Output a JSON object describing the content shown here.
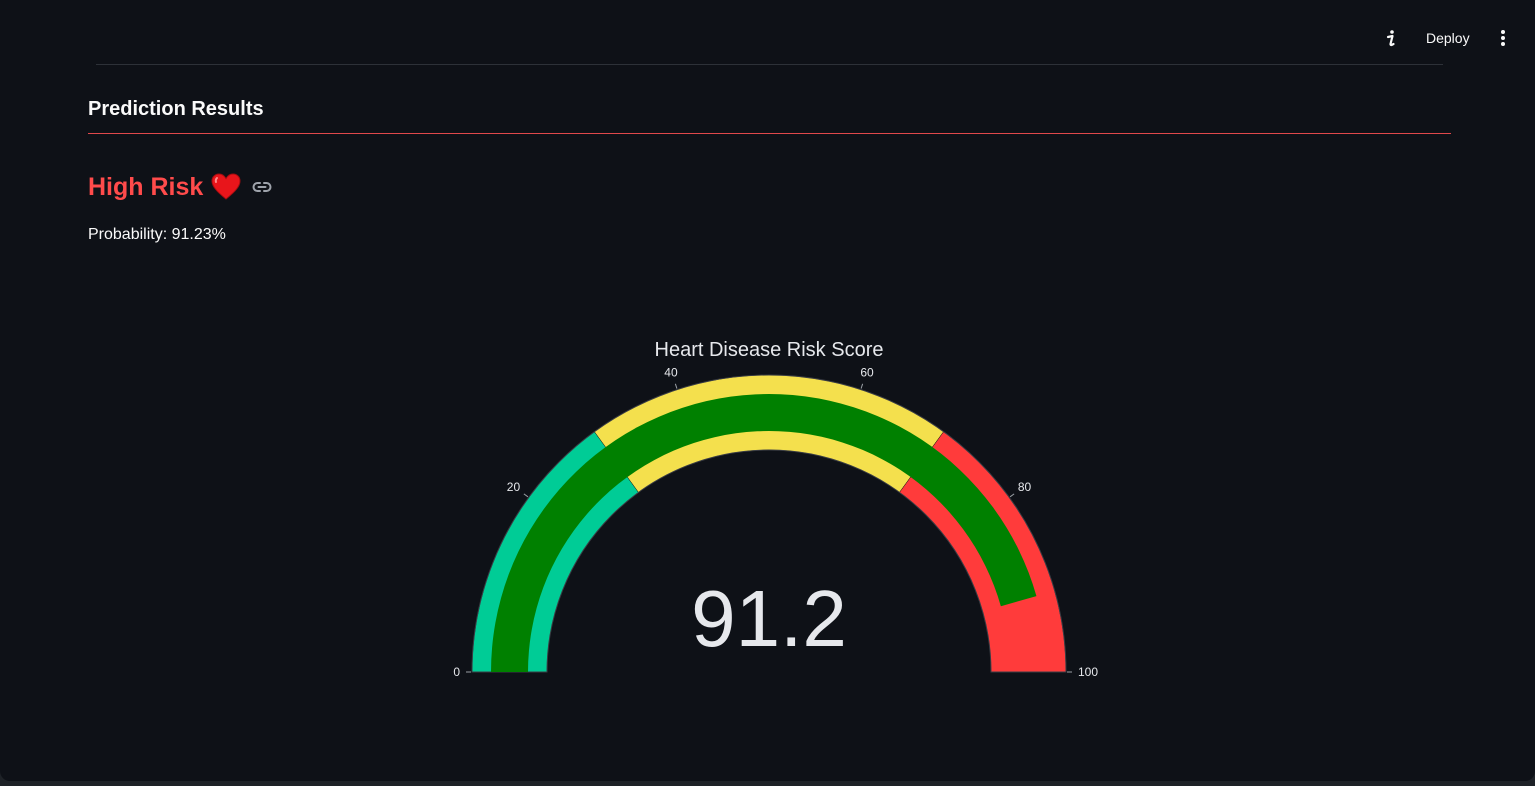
{
  "header": {
    "deploy_label": "Deploy",
    "icons": [
      "info-icon",
      "more-vertical-icon"
    ]
  },
  "section": {
    "title": "Prediction Results"
  },
  "result": {
    "risk_label": "High Risk",
    "risk_icon": "heart-icon",
    "link_icon": "link-icon",
    "probability_text": "Probability: 91.23%"
  },
  "colors": {
    "background": "#0e1117",
    "risk_red": "#ff4b4b",
    "band_low": "#00cc96",
    "band_mid": "#f4e04d",
    "band_high": "#ff3b3b",
    "bar": "#008000"
  },
  "chart_data": {
    "type": "gauge",
    "title": "Heart Disease Risk Score",
    "value": 91.2,
    "value_label": "91.2",
    "range": [
      0,
      100
    ],
    "ticks": [
      0,
      20,
      40,
      60,
      80,
      100
    ],
    "tick_labels": [
      "0",
      "20",
      "40",
      "60",
      "80",
      "100"
    ],
    "steps": [
      {
        "range": [
          0,
          30
        ],
        "color": "#00cc96"
      },
      {
        "range": [
          30,
          70
        ],
        "color": "#f4e04d"
      },
      {
        "range": [
          70,
          100
        ],
        "color": "#ff3b3b"
      }
    ],
    "bar_color": "#008000"
  }
}
